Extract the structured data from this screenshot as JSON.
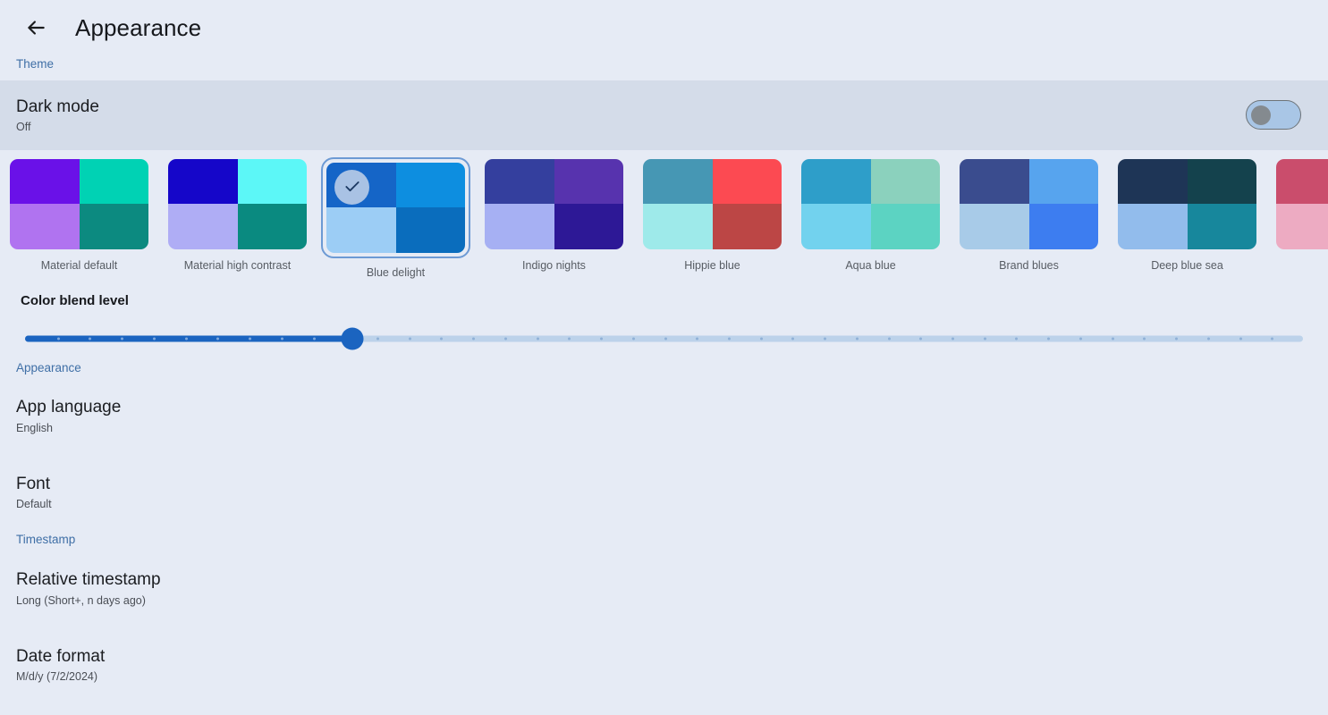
{
  "header": {
    "back_icon": "arrow-left-icon",
    "title": "Appearance"
  },
  "theme_section": {
    "label": "Theme",
    "dark_mode": {
      "title": "Dark mode",
      "value": "Off",
      "toggle_state": "off"
    },
    "slider": {
      "title": "Color blend level",
      "value_percent": 25.6,
      "min": 0,
      "max": 100,
      "tick_count": 40
    },
    "swatches": [
      {
        "label": "Material default",
        "selected": false,
        "colors": [
          "#6a11e8",
          "#00d2b4",
          "#b073f0",
          "#0c8a80"
        ]
      },
      {
        "label": "Material high contrast",
        "selected": false,
        "colors": [
          "#1506c9",
          "#5cf7f7",
          "#afadf5",
          "#0a8a80"
        ]
      },
      {
        "label": "Blue delight",
        "selected": true,
        "colors": [
          "#1565c7",
          "#0d8ee0",
          "#9ccdf5",
          "#0a6dbd"
        ]
      },
      {
        "label": "Indigo nights",
        "selected": false,
        "colors": [
          "#343f9e",
          "#5733ae",
          "#a6b0f3",
          "#2d1896"
        ]
      },
      {
        "label": "Hippie blue",
        "selected": false,
        "colors": [
          "#4697b4",
          "#fc4a52",
          "#9eeaea",
          "#bc4645"
        ]
      },
      {
        "label": "Aqua blue",
        "selected": false,
        "colors": [
          "#2e9ec9",
          "#8bd1bd",
          "#72d2ee",
          "#5cd3c2"
        ]
      },
      {
        "label": "Brand blues",
        "selected": false,
        "colors": [
          "#3a4c8e",
          "#57a4ee",
          "#a8cbe8",
          "#3d7df0"
        ]
      },
      {
        "label": "Deep blue sea",
        "selected": false,
        "colors": [
          "#1e3556",
          "#14424d",
          "#92bcec",
          "#17879c"
        ]
      },
      {
        "label": "",
        "selected": false,
        "colors": [
          "#ca4d6c",
          "#ca4d6c",
          "#edabc2",
          "#edabc2"
        ]
      }
    ]
  },
  "appearance_section": {
    "label": "Appearance",
    "rows": [
      {
        "title": "App language",
        "value": "English"
      },
      {
        "title": "Font",
        "value": "Default"
      }
    ]
  },
  "timestamp_section": {
    "label": "Timestamp",
    "rows": [
      {
        "title": "Relative timestamp",
        "value": "Long (Short+, n days ago)"
      },
      {
        "title": "Date format",
        "value": "M/d/y (7/2/2024)"
      }
    ]
  }
}
